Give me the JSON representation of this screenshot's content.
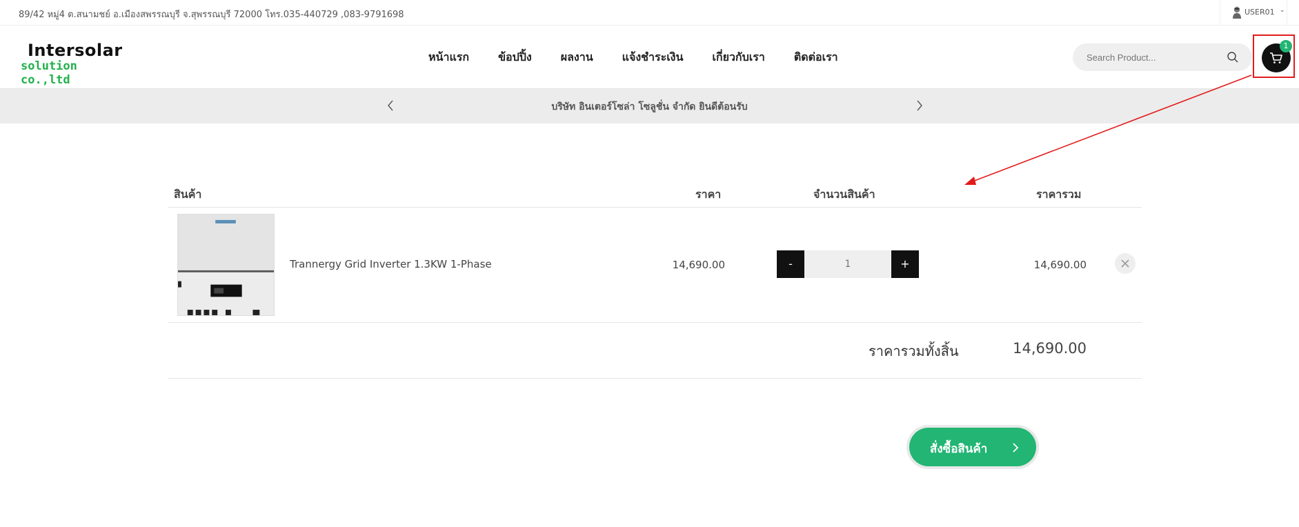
{
  "topbar": {
    "address": "89/42 หมู่4 ต.สนามชย์ อ.เมืองสพรรณบุรี จ.สุพรรณบุรี 72000 โทร.035-440729 ,083-9791698",
    "user_label": "USER01",
    "user_icon": "user-avatar-icon",
    "chevron_icon": "chevron-down-icon"
  },
  "header": {
    "logo_line1": "Intersolar",
    "logo_line2": "solution co.,ltd",
    "nav": [
      {
        "label": "หน้าแรก"
      },
      {
        "label": "ข้อปปิ้ง"
      },
      {
        "label": "ผลงาน"
      },
      {
        "label": "แจ้งชำระเงิน"
      },
      {
        "label": "เกี่ยวกับเรา"
      },
      {
        "label": "ติดต่อเรา"
      }
    ],
    "search_placeholder": "Search Product...",
    "cart_count": "1",
    "colors": {
      "accent": "#22b573",
      "logo_green": "#22b14c",
      "highlight": "#e31b1b"
    }
  },
  "announcement": {
    "message": "บริษัท อินเตอร์โซล่า โซลูชั่น จำกัด ยินดีต้อนรับ"
  },
  "cart": {
    "headers": {
      "product": "สินค้า",
      "price": "ราคา",
      "quantity": "จำนวนสินค้า",
      "total": "ราคารวม"
    },
    "items": [
      {
        "name": "Trannergy Grid Inverter 1.3KW 1-Phase",
        "price": "14,690.00",
        "quantity": "1",
        "total": "14,690.00",
        "minus_label": "-",
        "plus_label": "+"
      }
    ],
    "grand_total_label": "ราคารวมทั้งสิ้น",
    "grand_total_value": "14,690.00"
  },
  "checkout": {
    "label": "สั่งซื้อสินค้า"
  }
}
